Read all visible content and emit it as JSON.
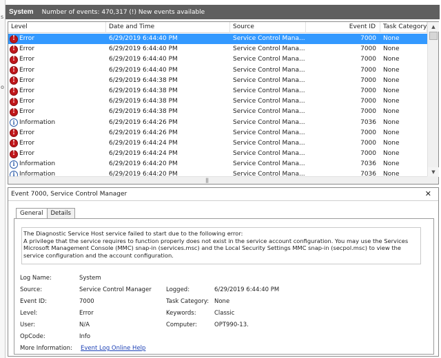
{
  "header": {
    "title": "System",
    "summary": "Number of events: 470,317 (!) New events available"
  },
  "grid": {
    "columns": [
      "Level",
      "Date and Time",
      "Source",
      "Event ID",
      "Task Category"
    ],
    "rows": [
      {
        "level": "Error",
        "icon": "error-icon",
        "date": "6/29/2019 6:44:40 PM",
        "source": "Service Control Mana...",
        "id": "7000",
        "task": "None",
        "selected": true
      },
      {
        "level": "Error",
        "icon": "error-icon",
        "date": "6/29/2019 6:44:40 PM",
        "source": "Service Control Mana...",
        "id": "7000",
        "task": "None"
      },
      {
        "level": "Error",
        "icon": "error-icon",
        "date": "6/29/2019 6:44:40 PM",
        "source": "Service Control Mana...",
        "id": "7000",
        "task": "None"
      },
      {
        "level": "Error",
        "icon": "error-icon",
        "date": "6/29/2019 6:44:40 PM",
        "source": "Service Control Mana...",
        "id": "7000",
        "task": "None"
      },
      {
        "level": "Error",
        "icon": "error-icon",
        "date": "6/29/2019 6:44:38 PM",
        "source": "Service Control Mana...",
        "id": "7000",
        "task": "None"
      },
      {
        "level": "Error",
        "icon": "error-icon",
        "date": "6/29/2019 6:44:38 PM",
        "source": "Service Control Mana...",
        "id": "7000",
        "task": "None"
      },
      {
        "level": "Error",
        "icon": "error-icon",
        "date": "6/29/2019 6:44:38 PM",
        "source": "Service Control Mana...",
        "id": "7000",
        "task": "None"
      },
      {
        "level": "Error",
        "icon": "error-icon",
        "date": "6/29/2019 6:44:38 PM",
        "source": "Service Control Mana...",
        "id": "7000",
        "task": "None"
      },
      {
        "level": "Information",
        "icon": "information-icon",
        "date": "6/29/2019 6:44:26 PM",
        "source": "Service Control Mana...",
        "id": "7036",
        "task": "None"
      },
      {
        "level": "Error",
        "icon": "error-icon",
        "date": "6/29/2019 6:44:26 PM",
        "source": "Service Control Mana...",
        "id": "7000",
        "task": "None"
      },
      {
        "level": "Error",
        "icon": "error-icon",
        "date": "6/29/2019 6:44:24 PM",
        "source": "Service Control Mana...",
        "id": "7000",
        "task": "None"
      },
      {
        "level": "Error",
        "icon": "error-icon",
        "date": "6/29/2019 6:44:24 PM",
        "source": "Service Control Mana...",
        "id": "7000",
        "task": "None"
      },
      {
        "level": "Information",
        "icon": "information-icon",
        "date": "6/29/2019 6:44:20 PM",
        "source": "Service Control Mana...",
        "id": "7036",
        "task": "None"
      },
      {
        "level": "Information",
        "icon": "information-icon",
        "date": "6/29/2019 6:44:20 PM",
        "source": "Service Control Mana...",
        "id": "7036",
        "task": "None"
      }
    ]
  },
  "detail": {
    "title": "Event 7000, Service Control Manager",
    "tabs": [
      "General",
      "Details"
    ],
    "description_lines": [
      "The Diagnostic Service Host service failed to start due to the following error:",
      "A privilege that the service requires to function properly does not exist in the service account configuration. You may use the Services",
      "Microsoft Management Console (MMC) snap-in (services.msc) and the Local Security Settings MMC snap-in (secpol.msc) to view the",
      "service configuration and the account configuration."
    ],
    "fields": {
      "log_name_label": "Log Name:",
      "log_name": "System",
      "source_label": "Source:",
      "source": "Service Control Manager",
      "logged_label": "Logged:",
      "logged": "6/29/2019 6:44:40 PM",
      "event_id_label": "Event ID:",
      "event_id": "7000",
      "task_label": "Task Category:",
      "task": "None",
      "level_label": "Level:",
      "level": "Error",
      "keywords_label": "Keywords:",
      "keywords": "Classic",
      "user_label": "User:",
      "user": "N/A",
      "computer_label": "Computer:",
      "computer": "OPT990-13.",
      "opcode_label": "OpCode:",
      "opcode": "Info",
      "more_info_label": "More Information:",
      "more_info_link": "Event Log Online Help"
    }
  },
  "colors": {
    "header_bg": "#5f5f5f",
    "selection": "#3399ff",
    "error_icon": "#c0171b",
    "info_icon": "#2a5aa8",
    "link": "#1a3fb5"
  }
}
